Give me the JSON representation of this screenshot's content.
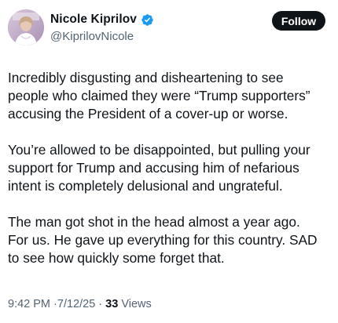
{
  "author": {
    "display_name": "Nicole Kiprilov",
    "handle": "@KiprilovNicole",
    "verified_icon": "verified-badge-icon",
    "verified_color": "#1d9bf0"
  },
  "follow_button": {
    "label": "Follow"
  },
  "tweet": {
    "paragraphs": [
      {
        "lines": [
          "Incredibly disgusting and disheartening to see",
          "people who claimed they were “Trump supporters”",
          "accusing the President of a cover-up or worse."
        ]
      },
      {
        "lines": [
          "You’re allowed to be disappointed, but pulling your",
          "support for Trump and accusing him of nefarious",
          "intent is completely delusional and ungrateful."
        ]
      },
      {
        "lines": [
          "The man got shot in the head almost a year ago.",
          "For us. He gave up everything for this country. SAD",
          "to see how quickly some forget that."
        ]
      }
    ]
  },
  "meta": {
    "time": "9:42 PM",
    "separator": "·",
    "date": "7/12/25",
    "views_count": "33",
    "views_label": "Views"
  },
  "colors": {
    "text_primary": "#0f1419",
    "text_secondary": "#536471",
    "button_bg": "#0f1419",
    "button_text": "#ffffff"
  }
}
